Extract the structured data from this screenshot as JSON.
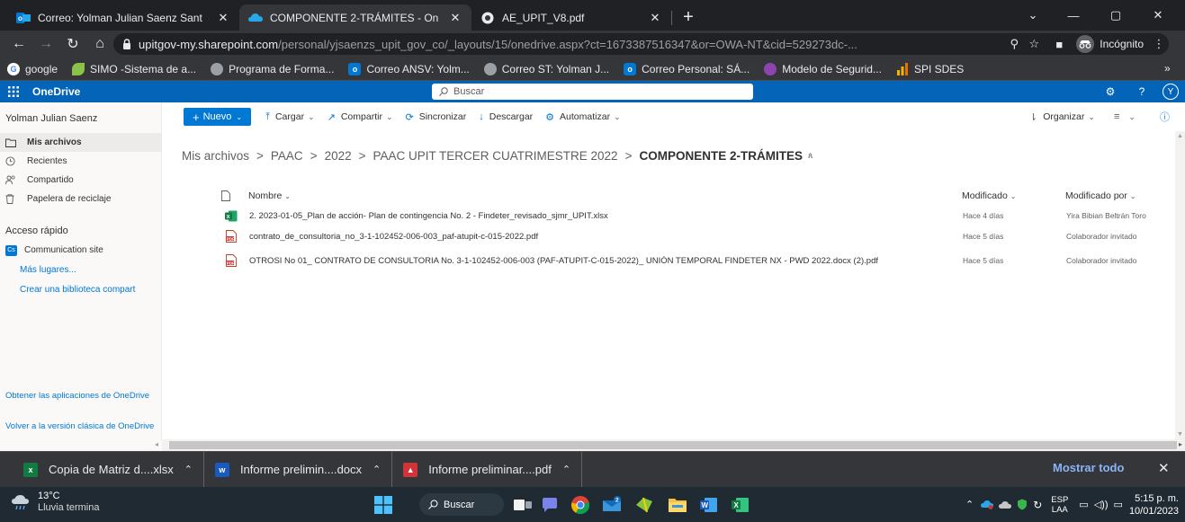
{
  "browser": {
    "tabs": [
      {
        "title": "Correo: Yolman Julian Saenz Sant",
        "active": false,
        "icon": "outlook-icon"
      },
      {
        "title": "COMPONENTE 2-TRÁMITES - On",
        "active": true,
        "icon": "onedrive-icon"
      },
      {
        "title": "AE_UPIT_V8.pdf",
        "active": false,
        "icon": "chrome-globe-icon"
      }
    ],
    "url_domain": "upitgov-my.sharepoint.com",
    "url_path": "/personal/yjsaenzs_upit_gov_co/_layouts/15/onedrive.aspx?ct=1673387516347&or=OWA-NT&cid=529273dc-...",
    "incognito_label": "Incógnito",
    "bookmarks": [
      {
        "label": "google",
        "icon": "google-icon",
        "color": "#4285f4"
      },
      {
        "label": "SIMO -Sistema de a...",
        "icon": "leaf-icon",
        "color": "#8bc34a"
      },
      {
        "label": "Programa de Forma...",
        "icon": "globe-icon",
        "color": "#9aa0a6"
      },
      {
        "label": "Correo ANSV: Yolm...",
        "icon": "outlook-icon",
        "color": "#0078d4"
      },
      {
        "label": "Correo ST: Yolman J...",
        "icon": "globe-icon",
        "color": "#9aa0a6"
      },
      {
        "label": "Correo Personal: SÁ...",
        "icon": "outlook-icon",
        "color": "#0078d4"
      },
      {
        "label": "Modelo de Segurid...",
        "icon": "shield-icon",
        "color": "#8e44ad"
      },
      {
        "label": "SPI SDES",
        "icon": "bar-chart-icon",
        "color": "#f4b400"
      }
    ]
  },
  "onedrive": {
    "brand": "OneDrive",
    "search_placeholder": "Buscar",
    "avatar_initial": "Y"
  },
  "sidebar": {
    "user": "Yolman Julian Saenz",
    "items": [
      {
        "label": "Mis archivos",
        "icon": "folder-icon",
        "selected": true
      },
      {
        "label": "Recientes",
        "icon": "clock-icon",
        "selected": false
      },
      {
        "label": "Compartido",
        "icon": "people-icon",
        "selected": false
      },
      {
        "label": "Papelera de reciclaje",
        "icon": "recycle-bin-icon",
        "selected": false
      }
    ],
    "quick_access_title": "Acceso rápido",
    "quick_access_site": "Communication site",
    "quick_access_site_badge": "Cs",
    "more_places": "Más lugares...",
    "create_library": "Crear una biblioteca compart",
    "get_apps": "Obtener las aplicaciones de OneDrive",
    "classic_version": "Volver a la versión clásica de OneDrive"
  },
  "commandbar": {
    "new_label": "Nuevo",
    "upload": "Cargar",
    "share": "Compartir",
    "sync": "Sincronizar",
    "download": "Descargar",
    "automate": "Automatizar",
    "sort": "Organizar"
  },
  "breadcrumb": {
    "items": [
      "Mis archivos",
      "PAAC",
      "2022",
      "PAAC UPIT TERCER CUATRIMESTRE 2022"
    ],
    "current": "COMPONENTE 2-TRÁMITES"
  },
  "table": {
    "col_name": "Nombre",
    "col_modified": "Modificado",
    "col_modified_by": "Modificado por",
    "rows": [
      {
        "name": "2. 2023-01-05_Plan de acción- Plan de contingencia No. 2 - Findeter_revisado_sjmr_UPIT.xlsx",
        "modified": "Hace 4 días",
        "modified_by": "Yira Bibian Beltrán Toro",
        "type": "xlsx"
      },
      {
        "name": "contrato_de_consultoria_no_3-1-102452-006-003_paf-atupit-c-015-2022.pdf",
        "modified": "Hace 5 días",
        "modified_by": "Colaborador invitado",
        "type": "pdf"
      },
      {
        "name": "OTROSI No 01_ CONTRATO DE CONSULTORIA No. 3-1-102452-006-003 (PAF-ATUPIT-C-015-2022)_ UNIÓN TEMPORAL FINDETER NX - PWD 2022.docx (2).pdf",
        "modified": "Hace 5 días",
        "modified_by": "Colaborador invitado",
        "type": "pdf"
      }
    ]
  },
  "downloads": {
    "items": [
      {
        "label": "Copia de Matriz d....xlsx",
        "type": "xlsx"
      },
      {
        "label": "Informe prelimin....docx",
        "type": "docx"
      },
      {
        "label": "Informe preliminar....pdf",
        "type": "pdf"
      }
    ],
    "show_all": "Mostrar todo"
  },
  "taskbar": {
    "temperature": "13°C",
    "weather_text": "Lluvia termina",
    "search_label": "Buscar",
    "language_top": "ESP",
    "language_bottom": "LAA",
    "time": "5:15 p. m.",
    "date": "10/01/2023"
  }
}
